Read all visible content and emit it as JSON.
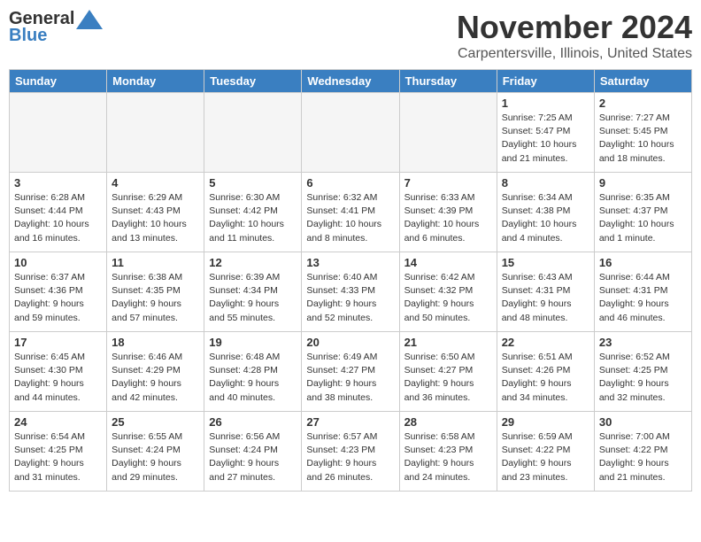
{
  "header": {
    "logo_line1": "General",
    "logo_line2": "Blue",
    "month": "November 2024",
    "location": "Carpentersville, Illinois, United States"
  },
  "weekdays": [
    "Sunday",
    "Monday",
    "Tuesday",
    "Wednesday",
    "Thursday",
    "Friday",
    "Saturday"
  ],
  "weeks": [
    [
      {
        "day": "",
        "empty": true
      },
      {
        "day": "",
        "empty": true
      },
      {
        "day": "",
        "empty": true
      },
      {
        "day": "",
        "empty": true
      },
      {
        "day": "",
        "empty": true
      },
      {
        "day": "1",
        "sunrise": "7:25 AM",
        "sunset": "5:47 PM",
        "daylight": "10 hours and 21 minutes."
      },
      {
        "day": "2",
        "sunrise": "7:27 AM",
        "sunset": "5:45 PM",
        "daylight": "10 hours and 18 minutes."
      }
    ],
    [
      {
        "day": "3",
        "sunrise": "6:28 AM",
        "sunset": "4:44 PM",
        "daylight": "10 hours and 16 minutes."
      },
      {
        "day": "4",
        "sunrise": "6:29 AM",
        "sunset": "4:43 PM",
        "daylight": "10 hours and 13 minutes."
      },
      {
        "day": "5",
        "sunrise": "6:30 AM",
        "sunset": "4:42 PM",
        "daylight": "10 hours and 11 minutes."
      },
      {
        "day": "6",
        "sunrise": "6:32 AM",
        "sunset": "4:41 PM",
        "daylight": "10 hours and 8 minutes."
      },
      {
        "day": "7",
        "sunrise": "6:33 AM",
        "sunset": "4:39 PM",
        "daylight": "10 hours and 6 minutes."
      },
      {
        "day": "8",
        "sunrise": "6:34 AM",
        "sunset": "4:38 PM",
        "daylight": "10 hours and 4 minutes."
      },
      {
        "day": "9",
        "sunrise": "6:35 AM",
        "sunset": "4:37 PM",
        "daylight": "10 hours and 1 minute."
      }
    ],
    [
      {
        "day": "10",
        "sunrise": "6:37 AM",
        "sunset": "4:36 PM",
        "daylight": "9 hours and 59 minutes."
      },
      {
        "day": "11",
        "sunrise": "6:38 AM",
        "sunset": "4:35 PM",
        "daylight": "9 hours and 57 minutes."
      },
      {
        "day": "12",
        "sunrise": "6:39 AM",
        "sunset": "4:34 PM",
        "daylight": "9 hours and 55 minutes."
      },
      {
        "day": "13",
        "sunrise": "6:40 AM",
        "sunset": "4:33 PM",
        "daylight": "9 hours and 52 minutes."
      },
      {
        "day": "14",
        "sunrise": "6:42 AM",
        "sunset": "4:32 PM",
        "daylight": "9 hours and 50 minutes."
      },
      {
        "day": "15",
        "sunrise": "6:43 AM",
        "sunset": "4:31 PM",
        "daylight": "9 hours and 48 minutes."
      },
      {
        "day": "16",
        "sunrise": "6:44 AM",
        "sunset": "4:31 PM",
        "daylight": "9 hours and 46 minutes."
      }
    ],
    [
      {
        "day": "17",
        "sunrise": "6:45 AM",
        "sunset": "4:30 PM",
        "daylight": "9 hours and 44 minutes."
      },
      {
        "day": "18",
        "sunrise": "6:46 AM",
        "sunset": "4:29 PM",
        "daylight": "9 hours and 42 minutes."
      },
      {
        "day": "19",
        "sunrise": "6:48 AM",
        "sunset": "4:28 PM",
        "daylight": "9 hours and 40 minutes."
      },
      {
        "day": "20",
        "sunrise": "6:49 AM",
        "sunset": "4:27 PM",
        "daylight": "9 hours and 38 minutes."
      },
      {
        "day": "21",
        "sunrise": "6:50 AM",
        "sunset": "4:27 PM",
        "daylight": "9 hours and 36 minutes."
      },
      {
        "day": "22",
        "sunrise": "6:51 AM",
        "sunset": "4:26 PM",
        "daylight": "9 hours and 34 minutes."
      },
      {
        "day": "23",
        "sunrise": "6:52 AM",
        "sunset": "4:25 PM",
        "daylight": "9 hours and 32 minutes."
      }
    ],
    [
      {
        "day": "24",
        "sunrise": "6:54 AM",
        "sunset": "4:25 PM",
        "daylight": "9 hours and 31 minutes."
      },
      {
        "day": "25",
        "sunrise": "6:55 AM",
        "sunset": "4:24 PM",
        "daylight": "9 hours and 29 minutes."
      },
      {
        "day": "26",
        "sunrise": "6:56 AM",
        "sunset": "4:24 PM",
        "daylight": "9 hours and 27 minutes."
      },
      {
        "day": "27",
        "sunrise": "6:57 AM",
        "sunset": "4:23 PM",
        "daylight": "9 hours and 26 minutes."
      },
      {
        "day": "28",
        "sunrise": "6:58 AM",
        "sunset": "4:23 PM",
        "daylight": "9 hours and 24 minutes."
      },
      {
        "day": "29",
        "sunrise": "6:59 AM",
        "sunset": "4:22 PM",
        "daylight": "9 hours and 23 minutes."
      },
      {
        "day": "30",
        "sunrise": "7:00 AM",
        "sunset": "4:22 PM",
        "daylight": "9 hours and 21 minutes."
      }
    ]
  ]
}
